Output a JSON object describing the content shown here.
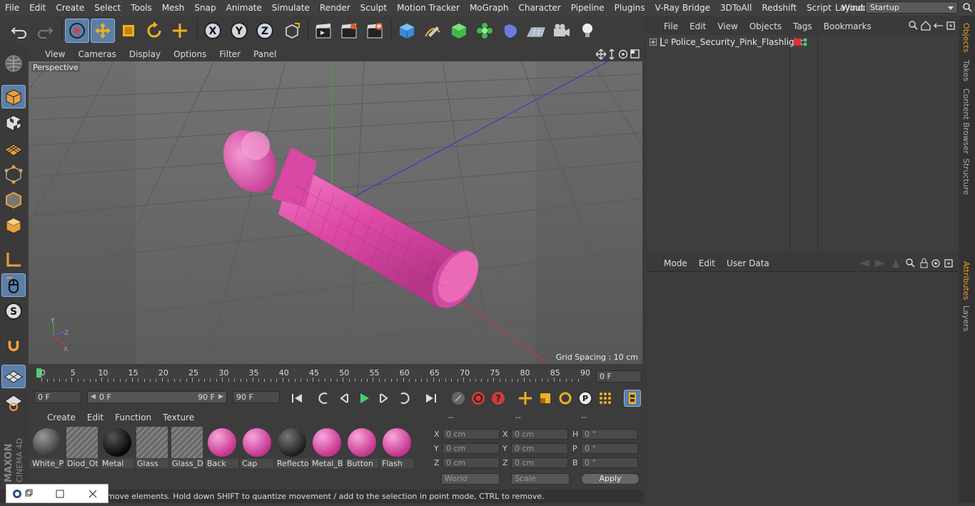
{
  "menu": [
    "File",
    "Edit",
    "Create",
    "Select",
    "Tools",
    "Mesh",
    "Snap",
    "Animate",
    "Simulate",
    "Render",
    "Sculpt",
    "Motion Tracker",
    "MoGraph",
    "Character",
    "Pipeline",
    "Plugins",
    "V-Ray Bridge",
    "3DToAll",
    "Redshift",
    "Script",
    "Window",
    "Help"
  ],
  "layout": {
    "label": "Layout:",
    "value": "Startup"
  },
  "viewport": {
    "menu": [
      "View",
      "Cameras",
      "Display",
      "Options",
      "Filter",
      "Panel"
    ],
    "label": "Perspective",
    "grid_spacing": "Grid Spacing : 10 cm"
  },
  "timeline": {
    "ticks": [
      "0",
      "5",
      "10",
      "15",
      "20",
      "25",
      "30",
      "35",
      "40",
      "45",
      "50",
      "55",
      "60",
      "65",
      "70",
      "75",
      "80",
      "85",
      "90"
    ],
    "current_frame": "0 F"
  },
  "controls": {
    "start": "0 F",
    "range_start": "0 F",
    "range_end": "90 F",
    "end": "90 F"
  },
  "materials": {
    "menu": [
      "Create",
      "Edit",
      "Function",
      "Texture"
    ],
    "items": [
      {
        "name": "White_P",
        "kind": "grey"
      },
      {
        "name": "Diod_Ot",
        "kind": "hatch"
      },
      {
        "name": "Metal",
        "kind": "black"
      },
      {
        "name": "Glass",
        "kind": "hatch"
      },
      {
        "name": "Glass_D",
        "kind": "hatch"
      },
      {
        "name": "Back",
        "kind": "pink"
      },
      {
        "name": "Cap",
        "kind": "pink"
      },
      {
        "name": "Reflecto",
        "kind": "dark"
      },
      {
        "name": "Metal_B",
        "kind": "pink"
      },
      {
        "name": "Button",
        "kind": "pink"
      },
      {
        "name": "Flash",
        "kind": "pink"
      }
    ]
  },
  "coords": {
    "headers": [
      "--",
      "--",
      "--"
    ],
    "rows": [
      {
        "l1": "X",
        "v1": "0 cm",
        "l2": "X",
        "v2": "0 cm",
        "l3": "H",
        "v3": "0 °"
      },
      {
        "l1": "Y",
        "v1": "0 cm",
        "l2": "Y",
        "v2": "0 cm",
        "l3": "P",
        "v3": "0 °"
      },
      {
        "l1": "Z",
        "v1": "0 cm",
        "l2": "Z",
        "v2": "0 cm",
        "l3": "B",
        "v3": "0 °"
      }
    ],
    "mode": "World",
    "scale": "Scale",
    "apply": "Apply"
  },
  "status": "move elements. Hold down SHIFT to quantize movement / add to the selection in point mode, CTRL to remove.",
  "objects": {
    "menu": [
      "File",
      "Edit",
      "View",
      "Objects",
      "Tags",
      "Bookmarks"
    ],
    "items": [
      {
        "name": "Police_Security_Pink_Flashlight"
      }
    ]
  },
  "attributes": {
    "menu": [
      "Mode",
      "Edit",
      "User Data"
    ]
  },
  "side_tabs": [
    "Objects",
    "Takes",
    "Content Browser",
    "Structure",
    "Attributes",
    "Layers"
  ],
  "logo": {
    "line1": "MAXON",
    "line2": "CINEMA 4D"
  },
  "colors": {
    "accent": "#5a7fa8",
    "pink": "#e04aa8",
    "object_red": "#e03030",
    "tab_active": "#e8a020"
  }
}
